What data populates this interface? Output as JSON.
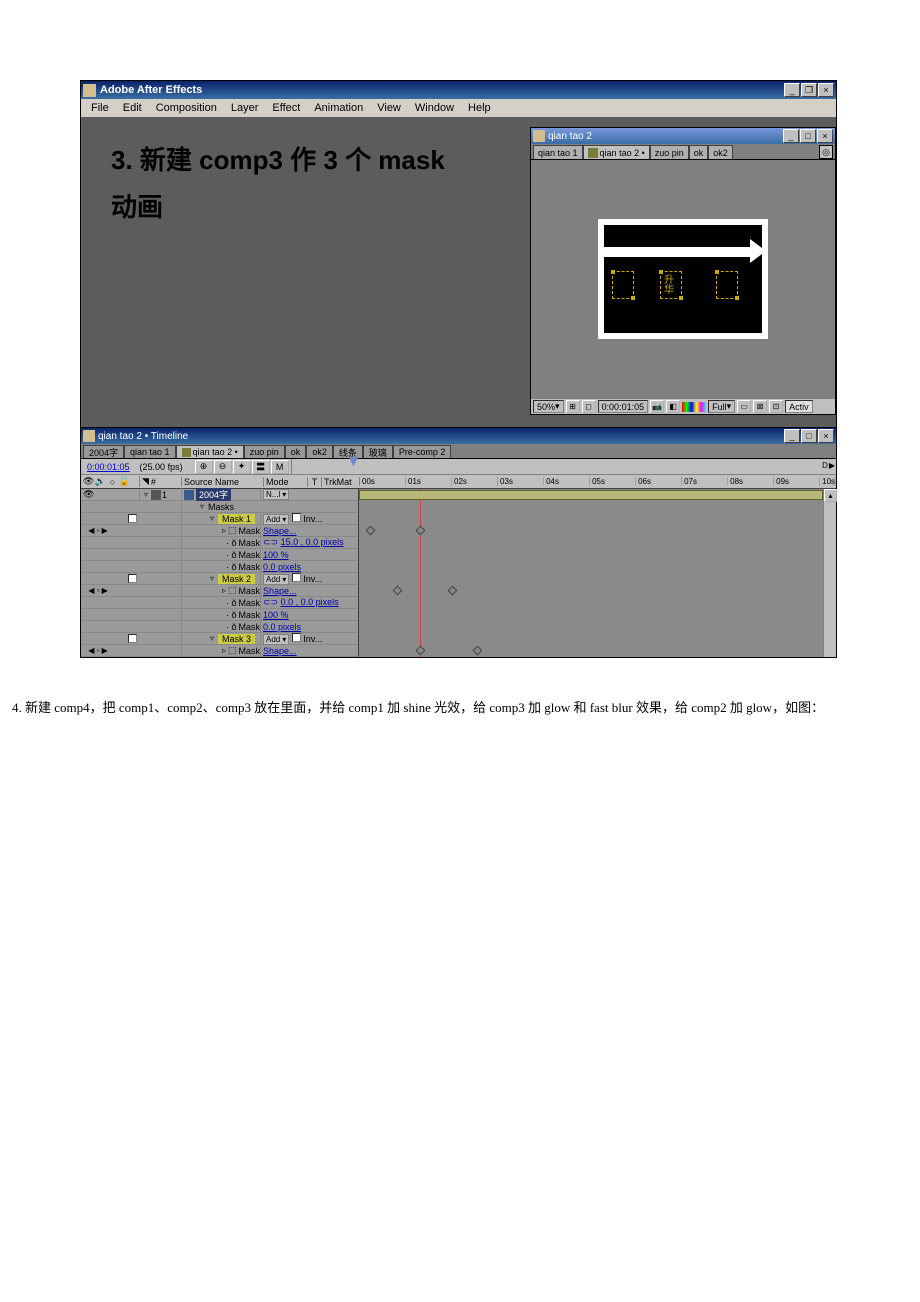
{
  "app": {
    "title": "Adobe After Effects",
    "menubar": [
      "File",
      "Edit",
      "Composition",
      "Layer",
      "Effect",
      "Animation",
      "View",
      "Window",
      "Help"
    ]
  },
  "overlay": {
    "line1": "3. 新建 comp3 作 3 个 mask",
    "line2": "动画"
  },
  "comp_panel": {
    "title": "qian tao 2",
    "tabs": [
      "qian tao 1",
      "qian tao 2 •",
      "zuo pin",
      "ok",
      "ok2"
    ],
    "footer": {
      "zoom": "50%",
      "time": "0:00:01:05",
      "res": "Full",
      "active": "Activ"
    }
  },
  "timeline": {
    "title": "qian tao 2 • Timeline",
    "tabs": [
      "2004字",
      "qian tao 1",
      "qian tao 2 •",
      "zuo pin",
      "ok",
      "ok2",
      "线条",
      "玻璃",
      "Pre-comp 2"
    ],
    "current_time": "0:00:01:05",
    "fps": "(25.00 fps)",
    "cols": {
      "source": "Source Name",
      "mode": "Mode",
      "t": "T",
      "trk": "TrkMat"
    },
    "ticks": [
      "00s",
      "01s",
      "02s",
      "03s",
      "04s",
      "05s",
      "06s",
      "07s",
      "08s",
      "09s",
      "10s"
    ],
    "layer1": {
      "num": "1",
      "name": "2004字",
      "mode": "N...l"
    },
    "masks_label": "Masks",
    "m1": {
      "name": "Mask 1",
      "mode": "Add",
      "inv": "Inv...",
      "shape_lbl": "Mask Shape",
      "shape_val": "Shape...",
      "feather_lbl": "Mask Feather",
      "feather_val": "15.0 , 0.0 pixels",
      "opacity_lbl": "Mask Opacity",
      "opacity_val": "100 %",
      "expa_lbl": "Mask Expa...",
      "expa_val": "0.0 pixels"
    },
    "m2": {
      "name": "Mask 2",
      "mode": "Add",
      "inv": "Inv...",
      "shape_lbl": "Mask Shape",
      "shape_val": "Shape...",
      "feather_lbl": "Mask Feather",
      "feather_val": "0.0 , 0.0 pixels",
      "opacity_lbl": "Mask Opacity",
      "opacity_val": "100 %",
      "expa_lbl": "Mask Expa...",
      "expa_val": "0.0 pixels"
    },
    "m3": {
      "name": "Mask 3",
      "mode": "Add",
      "inv": "Inv...",
      "shape_lbl": "Mask Shape",
      "shape_val": "Shape..."
    }
  },
  "footer_text": "4. 新建 comp4，把 comp1、comp2、comp3 放在里面，并给 comp1 加 shine 光效，给 comp3 加  glow  和  fast blur  效果，给 comp2 加  glow，如图："
}
